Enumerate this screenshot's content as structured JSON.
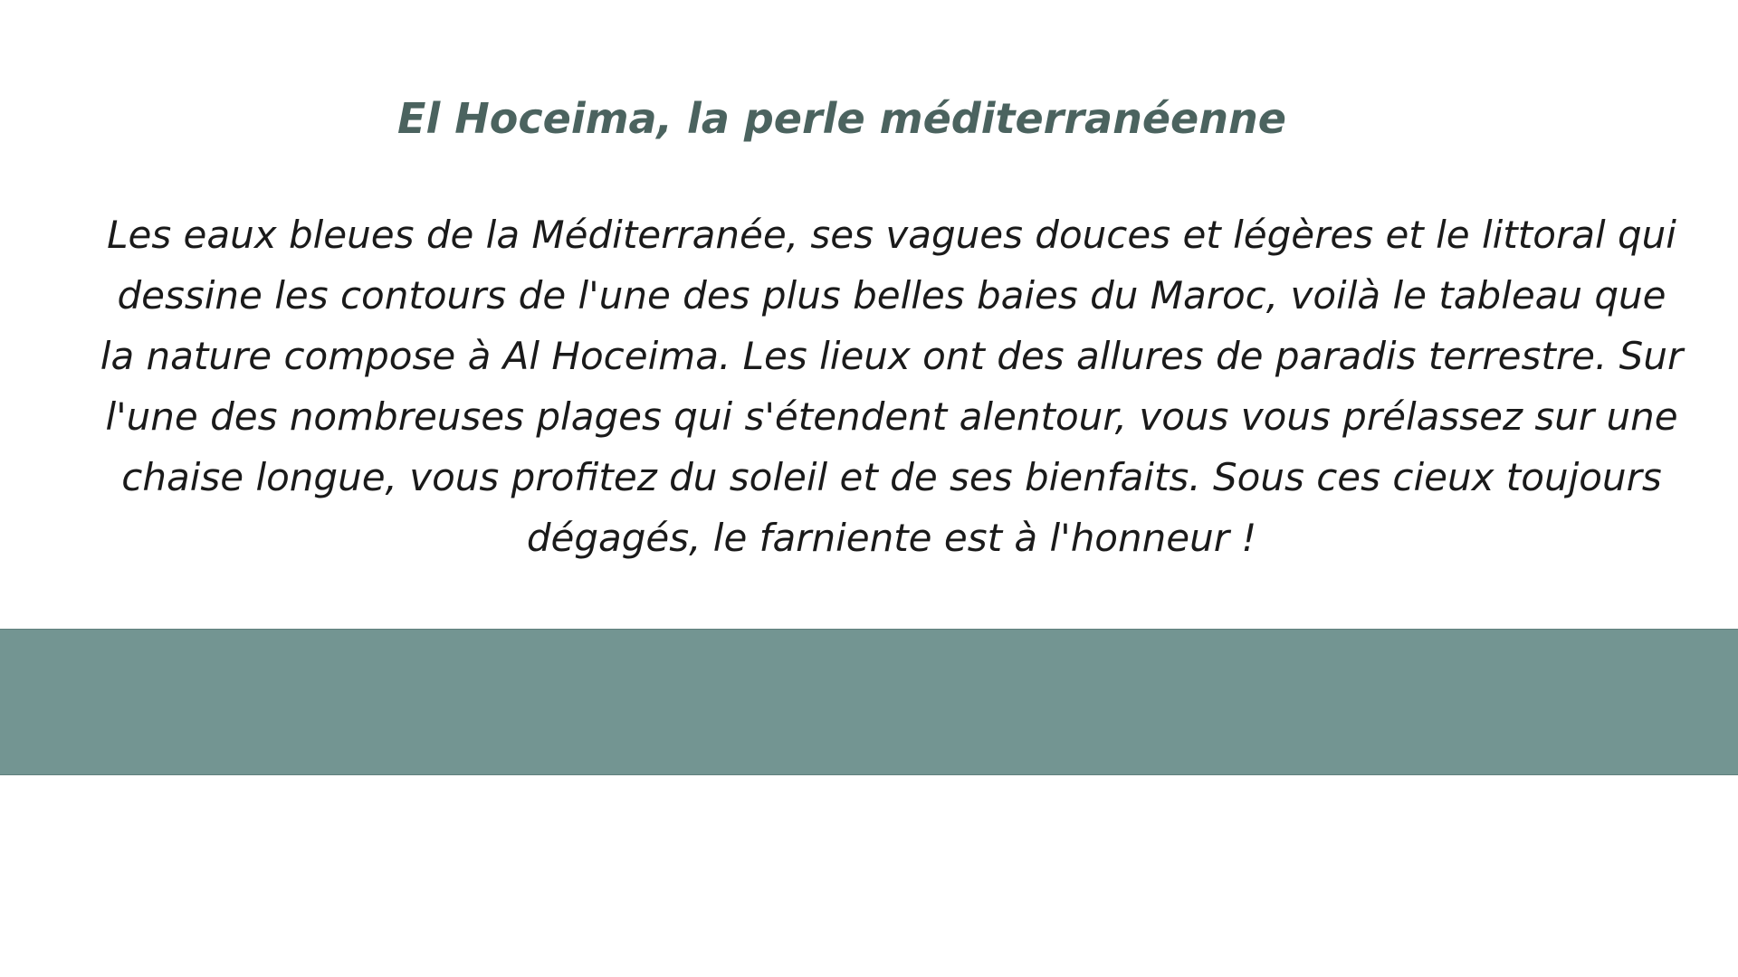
{
  "slide": {
    "title": "El Hoceima, la perle méditerranéenne",
    "body": "Les eaux bleues de la Méditerranée, ses vagues douces et légères et le littoral qui dessine les contours de l'une des plus belles baies du Maroc, voilà le tableau que la nature compose à Al Hoceima. Les lieux ont des allures de paradis terrestre. Sur l'une des nombreuses plages qui s'étendent alentour, vous vous prélassez sur une chaise longue, vous profitez du soleil et de ses bienfaits. Sous ces cieux toujours dégagés, le farniente est à l'honneur !"
  },
  "colors": {
    "title": "#4b635f",
    "body_text": "#1a1a1a",
    "footer_band": "#739592",
    "background": "#ffffff"
  }
}
